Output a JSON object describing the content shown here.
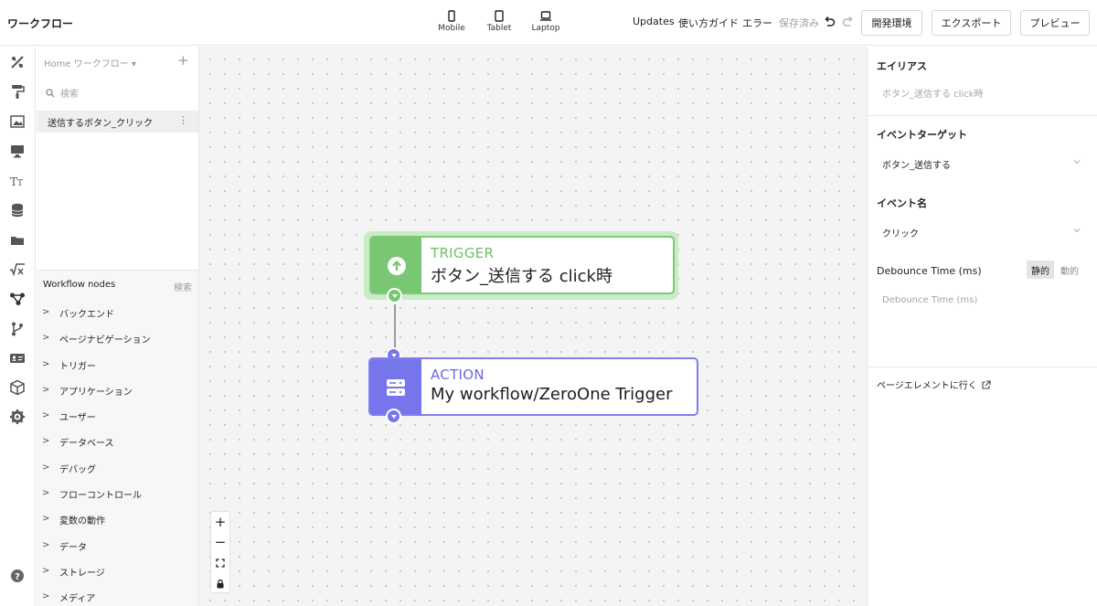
{
  "app": {
    "title": "ワークフロー"
  },
  "devices": [
    {
      "label": "Mobile",
      "icon": "mobile-icon"
    },
    {
      "label": "Tablet",
      "icon": "tablet-icon"
    },
    {
      "label": "Laptop",
      "icon": "laptop-icon"
    }
  ],
  "toolbar": {
    "updates": "Updates",
    "guide": "使い方ガイド",
    "errors": "エラー",
    "saved": "保存済み",
    "undo_icon": "undo-icon",
    "redo_icon": "redo-icon",
    "dev_env": "開発環境",
    "export": "エクスポート",
    "preview": "プレビュー"
  },
  "rail": {
    "icons": [
      "tools-icon",
      "paint-roller-icon",
      "image-frame-icon",
      "monitor-icon",
      "typography-icon",
      "database-icon",
      "folder-icon",
      "formula-icon",
      "workflow-icon",
      "git-branch-icon",
      "id-card-icon",
      "package-icon",
      "settings-icon",
      "help-icon"
    ]
  },
  "sidebar": {
    "header": "Home ワークフロー ▾",
    "add": "+",
    "search_placeholder": "検索",
    "workflow_item": "送信するボタン_クリック",
    "nodes_title": "Workflow nodes",
    "nodes_search": "検索",
    "categories": [
      "バックエンド",
      "ページナビゲーション",
      "トリガー",
      "アプリケーション",
      "ユーザー",
      "データベース",
      "デバッグ",
      "フローコントロール",
      "変数の動作",
      "データ",
      "ストレージ",
      "メディア"
    ]
  },
  "canvas": {
    "trigger": {
      "kind": "TRIGGER",
      "name": "ボタン_送信する click時",
      "icon": "arrow-up-circle-icon"
    },
    "action": {
      "kind": "ACTION",
      "name": "My workflow/ZeroOne Trigger",
      "icon": "server-icon"
    },
    "zoom": [
      "+",
      "−"
    ]
  },
  "colors": {
    "trigger_accent": "#79c673",
    "action_accent": "#7675ec"
  },
  "panel": {
    "alias_label": "エイリアス",
    "alias_placeholder": "ボタン_送信する click時",
    "target_label": "イベントターゲット",
    "target_value": "ボタン_送信する",
    "event_label": "イベント名",
    "event_value": "クリック",
    "debounce_label": "Debounce Time (ms)",
    "static": "静的",
    "dynamic": "動的",
    "debounce_placeholder": "Debounce Time (ms)",
    "goto_element": "ページエレメントに行く"
  }
}
